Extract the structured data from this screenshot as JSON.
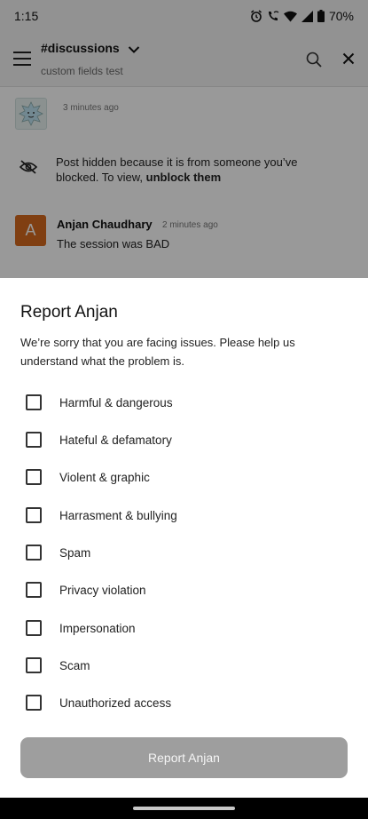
{
  "status_bar": {
    "time": "1:15",
    "battery": "70%",
    "icons": [
      "alarm-icon",
      "phone-wifi-icon",
      "wifi-icon",
      "signal-icon",
      "battery-icon"
    ]
  },
  "app_bar": {
    "channel": "#discussions",
    "subtitle": "custom fields test",
    "icons": [
      "menu-icon",
      "chevron-down-icon",
      "search-icon",
      "close-icon"
    ]
  },
  "feed": {
    "first_timestamp": "3 minutes ago",
    "hidden_notice": "Post hidden because it is from someone you’ve blocked. To view, ",
    "unblock_link": "unblock them",
    "message": {
      "avatar_letter": "A",
      "author": "Anjan Chaudhary",
      "time": "2 minutes ago",
      "text": "The session was BAD",
      "avatar_color": "#d56a1e"
    }
  },
  "sheet": {
    "title": "Report Anjan",
    "description": "We’re sorry that you are facing issues. Please help us understand what the problem is.",
    "options": [
      "Harmful & dangerous",
      "Hateful & defamatory",
      "Violent & graphic",
      "Harrasment & bullying",
      "Spam",
      "Privacy violation",
      "Impersonation",
      "Scam",
      "Unauthorized access"
    ],
    "submit_label": "Report Anjan"
  },
  "colors": {
    "button_disabled": "#9e9e9e",
    "scrim": "rgba(0,0,0,0.40)"
  }
}
